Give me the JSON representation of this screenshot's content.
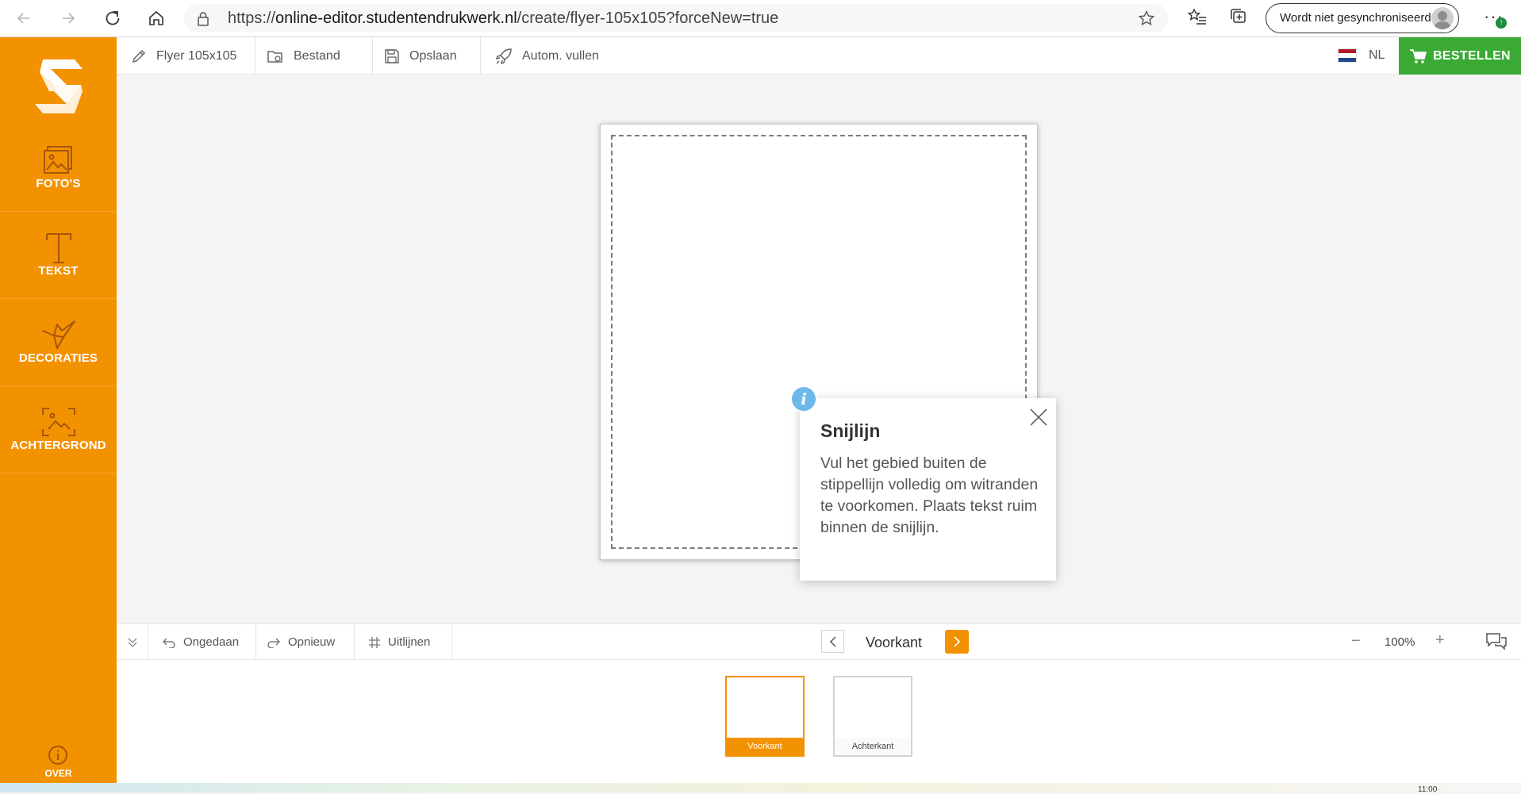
{
  "browser": {
    "url_prefix": "https://",
    "url_host": "online-editor.studentendrukwerk.nl",
    "url_path": "/create/flyer-105x105?forceNew=true",
    "sync_label": "Wordt niet gesynchroniseerd",
    "more_label": "···"
  },
  "sidebar": {
    "items": [
      {
        "label": "FOTO'S",
        "icon": "photo-icon"
      },
      {
        "label": "TEKST",
        "icon": "text-icon"
      },
      {
        "label": "DECORATIES",
        "icon": "origami-bird-icon"
      },
      {
        "label": "ACHTERGROND",
        "icon": "background-icon"
      }
    ],
    "about_label": "OVER"
  },
  "toolbar": {
    "product_label": "Flyer 105x105",
    "file_label": "Bestand",
    "save_label": "Opslaan",
    "autofill_label": "Autom. vullen",
    "language": "NL",
    "order_label": "BESTELLEN"
  },
  "tooltip": {
    "title": "Snijlijn",
    "body": "Vul het gebied buiten de stippellijn volledig om witranden te voorkomen. Plaats tekst ruim binnen de snijlijn."
  },
  "bottom_bar": {
    "undo_label": "Ongedaan",
    "redo_label": "Opnieuw",
    "align_label": "Uitlijnen",
    "page_label": "Voorkant",
    "zoom": "100%",
    "zoom_minus": "−",
    "zoom_plus": "+"
  },
  "thumbnails": [
    {
      "label": "Voorkant",
      "active": true
    },
    {
      "label": "Achterkant",
      "active": false
    }
  ],
  "colors": {
    "brand_orange": "#f39200",
    "order_green": "#3aaa35",
    "info_blue": "#6fb8ea"
  },
  "clock": "11:00"
}
